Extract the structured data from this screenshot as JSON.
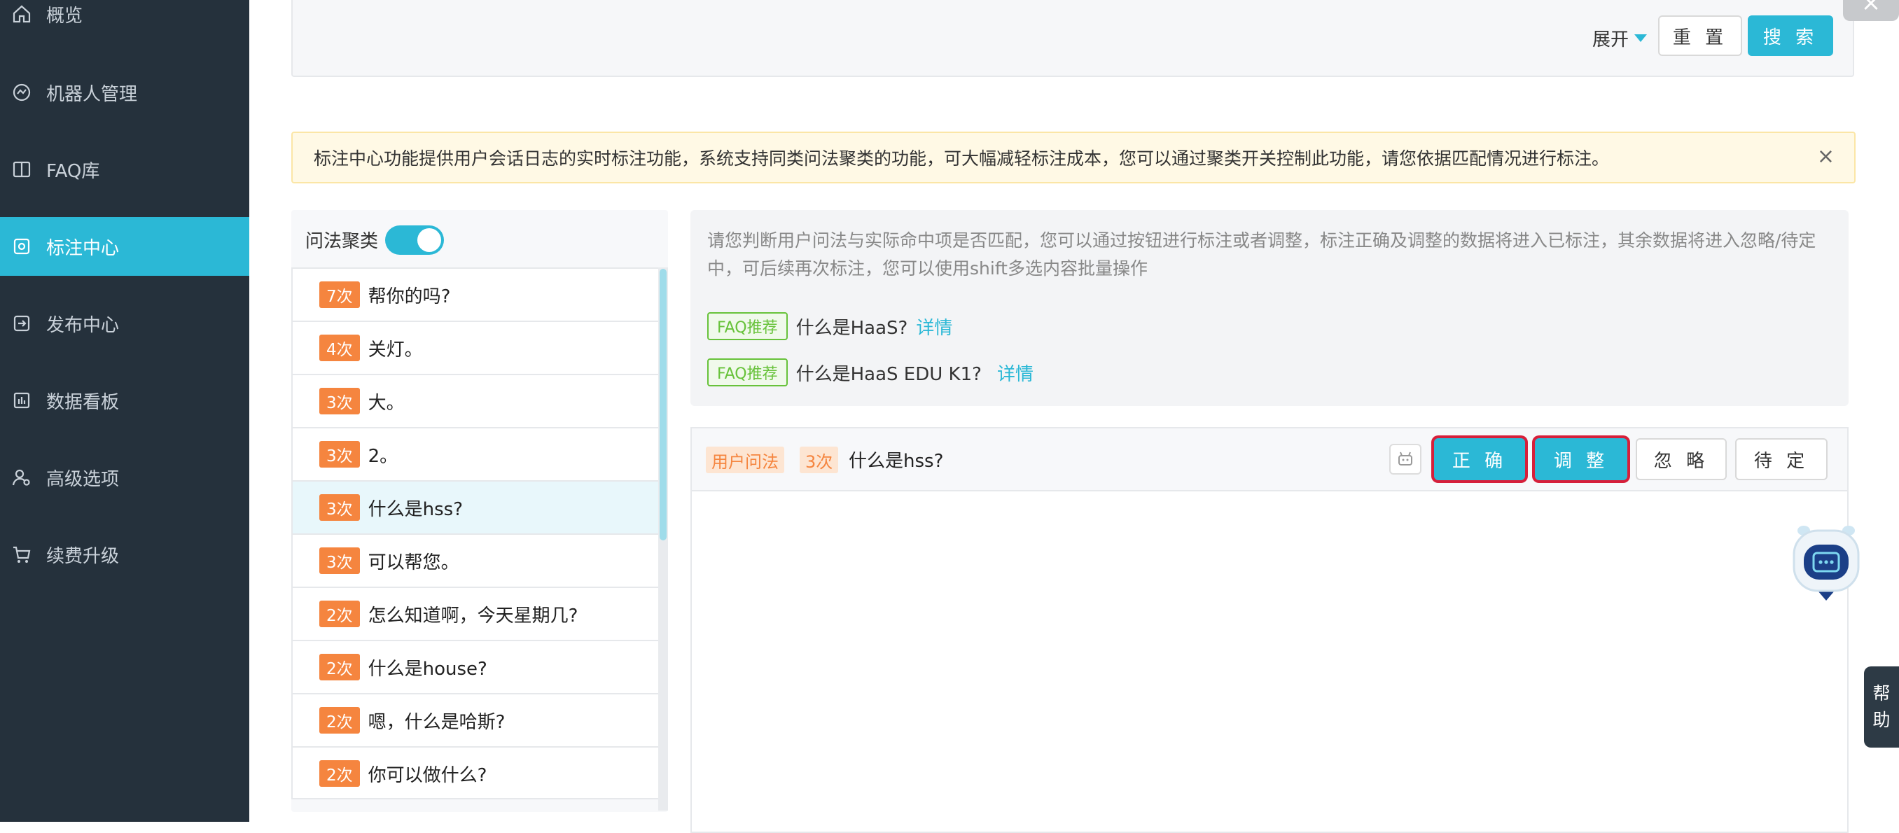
{
  "sidebar": {
    "items": [
      {
        "label": "概览",
        "icon": "home-icon"
      },
      {
        "label": "机器人管理",
        "icon": "robot-management-icon"
      },
      {
        "label": "FAQ库",
        "icon": "book-icon"
      },
      {
        "label": "标注中心",
        "icon": "annotation-icon",
        "active": true
      },
      {
        "label": "发布中心",
        "icon": "publish-icon"
      },
      {
        "label": "数据看板",
        "icon": "dashboard-icon"
      },
      {
        "label": "高级选项",
        "icon": "user-settings-icon"
      },
      {
        "label": "续费升级",
        "icon": "cart-icon"
      }
    ]
  },
  "filter": {
    "expand_label": "展开",
    "reset_label": "重 置",
    "search_label": "搜 索"
  },
  "notice": {
    "text": "标注中心功能提供用户会话日志的实时标注功能，系统支持同类问法聚类的功能，可大幅减轻标注成本，您可以通过聚类开关控制此功能，请您依据匹配情况进行标注。",
    "close": "×"
  },
  "cluster": {
    "toggle_label": "问法聚类",
    "enabled": true
  },
  "list": [
    {
      "count": "7次",
      "text": "帮你的吗?"
    },
    {
      "count": "4次",
      "text": "关灯。"
    },
    {
      "count": "3次",
      "text": "大。"
    },
    {
      "count": "3次",
      "text": "2。"
    },
    {
      "count": "3次",
      "text": "什么是hss?",
      "selected": true
    },
    {
      "count": "3次",
      "text": "可以帮您。"
    },
    {
      "count": "2次",
      "text": "怎么知道啊，今天星期几?"
    },
    {
      "count": "2次",
      "text": "什么是house?"
    },
    {
      "count": "2次",
      "text": "嗯，什么是哈斯?"
    },
    {
      "count": "2次",
      "text": "你可以做什么?"
    }
  ],
  "hint": {
    "text": "请您判断用户问法与实际命中项是否匹配，您可以通过按钮进行标注或者调整，标注正确及调整的数据将进入已标注，其余数据将进入忽略/待定中，可后续再次标注，您可以使用shift多选内容批量操作",
    "faqs": [
      {
        "tag": "FAQ推荐",
        "question": "什么是HaaS?",
        "link": "详情"
      },
      {
        "tag": "FAQ推荐",
        "question": "什么是HaaS EDU K1?",
        "link": "详情"
      }
    ]
  },
  "question": {
    "type_tag": "用户问法",
    "count_tag": "3次",
    "text": "什么是hss?",
    "buttons": {
      "correct": "正 确",
      "adjust": "调 整",
      "ignore": "忽 略",
      "pending": "待 定"
    }
  },
  "help": {
    "char1": "帮",
    "char2": "助"
  },
  "colors": {
    "sidebar_bg": "#25313c",
    "accent": "#2bb8d6",
    "badge_orange": "#f5853f",
    "faq_green": "#67c23a",
    "highlight_red": "#d61f3a"
  }
}
